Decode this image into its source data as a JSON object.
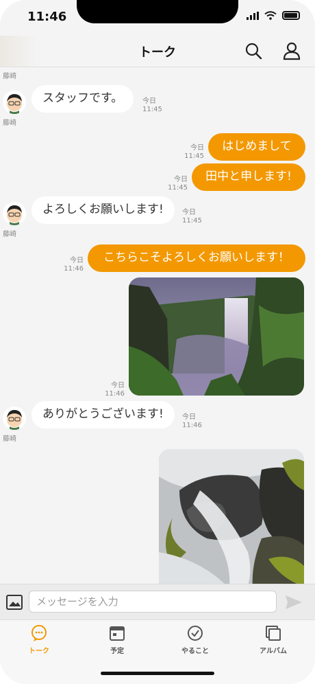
{
  "status_bar": {
    "time": "11:46"
  },
  "header": {
    "title": "トーク",
    "search_icon": "search-icon",
    "profile_icon": "person-icon"
  },
  "messages": [
    {
      "type": "incoming_name",
      "name": "藤崎"
    },
    {
      "type": "incoming",
      "text": "スタッフです。",
      "day": "今日",
      "time": "11:45",
      "sender": "藤崎"
    },
    {
      "type": "outgoing",
      "text": "はじめまして",
      "day": "今日",
      "time": "11:45"
    },
    {
      "type": "outgoing",
      "text": "田中と申します!",
      "day": "今日",
      "time": "11:45"
    },
    {
      "type": "incoming",
      "text": "よろしくお願いします!",
      "day": "今日",
      "time": "11:45",
      "sender": "藤崎"
    },
    {
      "type": "outgoing",
      "text": "こちらこそよろしくお願いします！",
      "day": "今日",
      "time": "11:46"
    },
    {
      "type": "outgoing_image",
      "subject": "waterfall-canyon-photo",
      "day": "今日",
      "time": "11:46"
    },
    {
      "type": "incoming",
      "text": "ありがとうございます!",
      "day": "今日",
      "time": "11:46",
      "sender": "藤崎"
    },
    {
      "type": "outgoing_image",
      "subject": "waterfall-rocks-photo"
    }
  ],
  "input": {
    "placeholder": "メッセージを入力",
    "value": ""
  },
  "tabs": [
    {
      "label": "トーク",
      "icon": "chat-icon",
      "active": true
    },
    {
      "label": "予定",
      "icon": "calendar-icon",
      "active": false
    },
    {
      "label": "やること",
      "icon": "check-circle-icon",
      "active": false
    },
    {
      "label": "アルバム",
      "icon": "album-icon",
      "active": false
    }
  ],
  "colors": {
    "accent": "#f39800",
    "incoming_bubble": "#ffffff",
    "background": "#f4f4f4"
  }
}
